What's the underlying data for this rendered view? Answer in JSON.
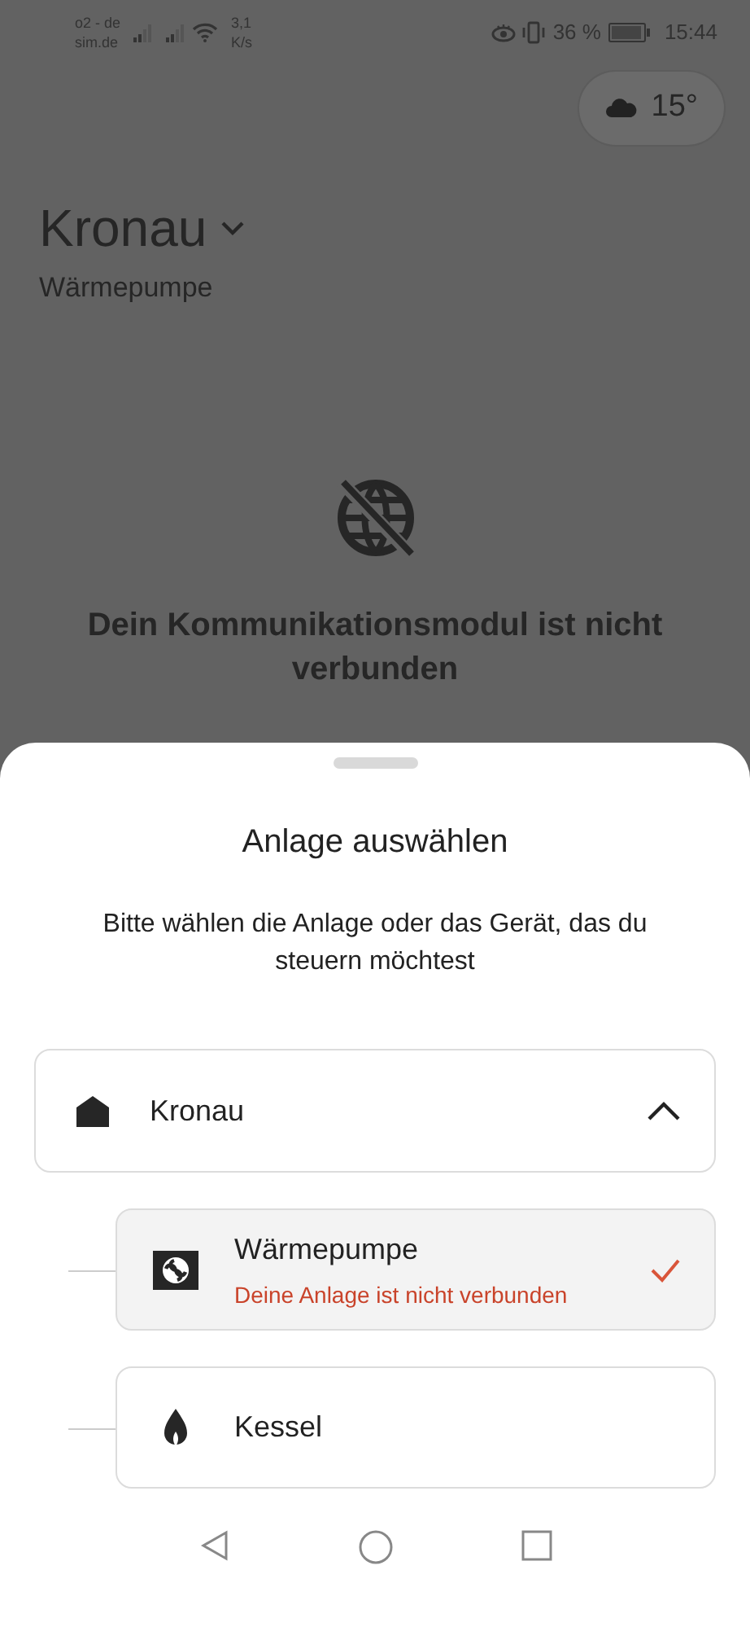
{
  "status_bar": {
    "carrier": [
      "o2 - de",
      "sim.de"
    ],
    "speed": [
      "3,1",
      "K/s"
    ],
    "battery": "36 %",
    "time": "15:44"
  },
  "weather": {
    "temperature": "15°"
  },
  "header": {
    "title": "Kronau",
    "subtitle": "Wärmepumpe",
    "message": "Dein Kommunikationsmodul ist nicht verbunden"
  },
  "sheet": {
    "title": "Anlage auswählen",
    "description": "Bitte wählen die Anlage oder das Gerät, das du steuern möchtest",
    "site": {
      "name": "Kronau",
      "expanded": true,
      "devices": [
        {
          "name": "Wärmepumpe",
          "kind": "heat_pump",
          "selected": true,
          "status": "Deine Anlage ist nicht verbunden"
        },
        {
          "name": "Kessel",
          "kind": "boiler",
          "selected": false
        }
      ]
    }
  }
}
